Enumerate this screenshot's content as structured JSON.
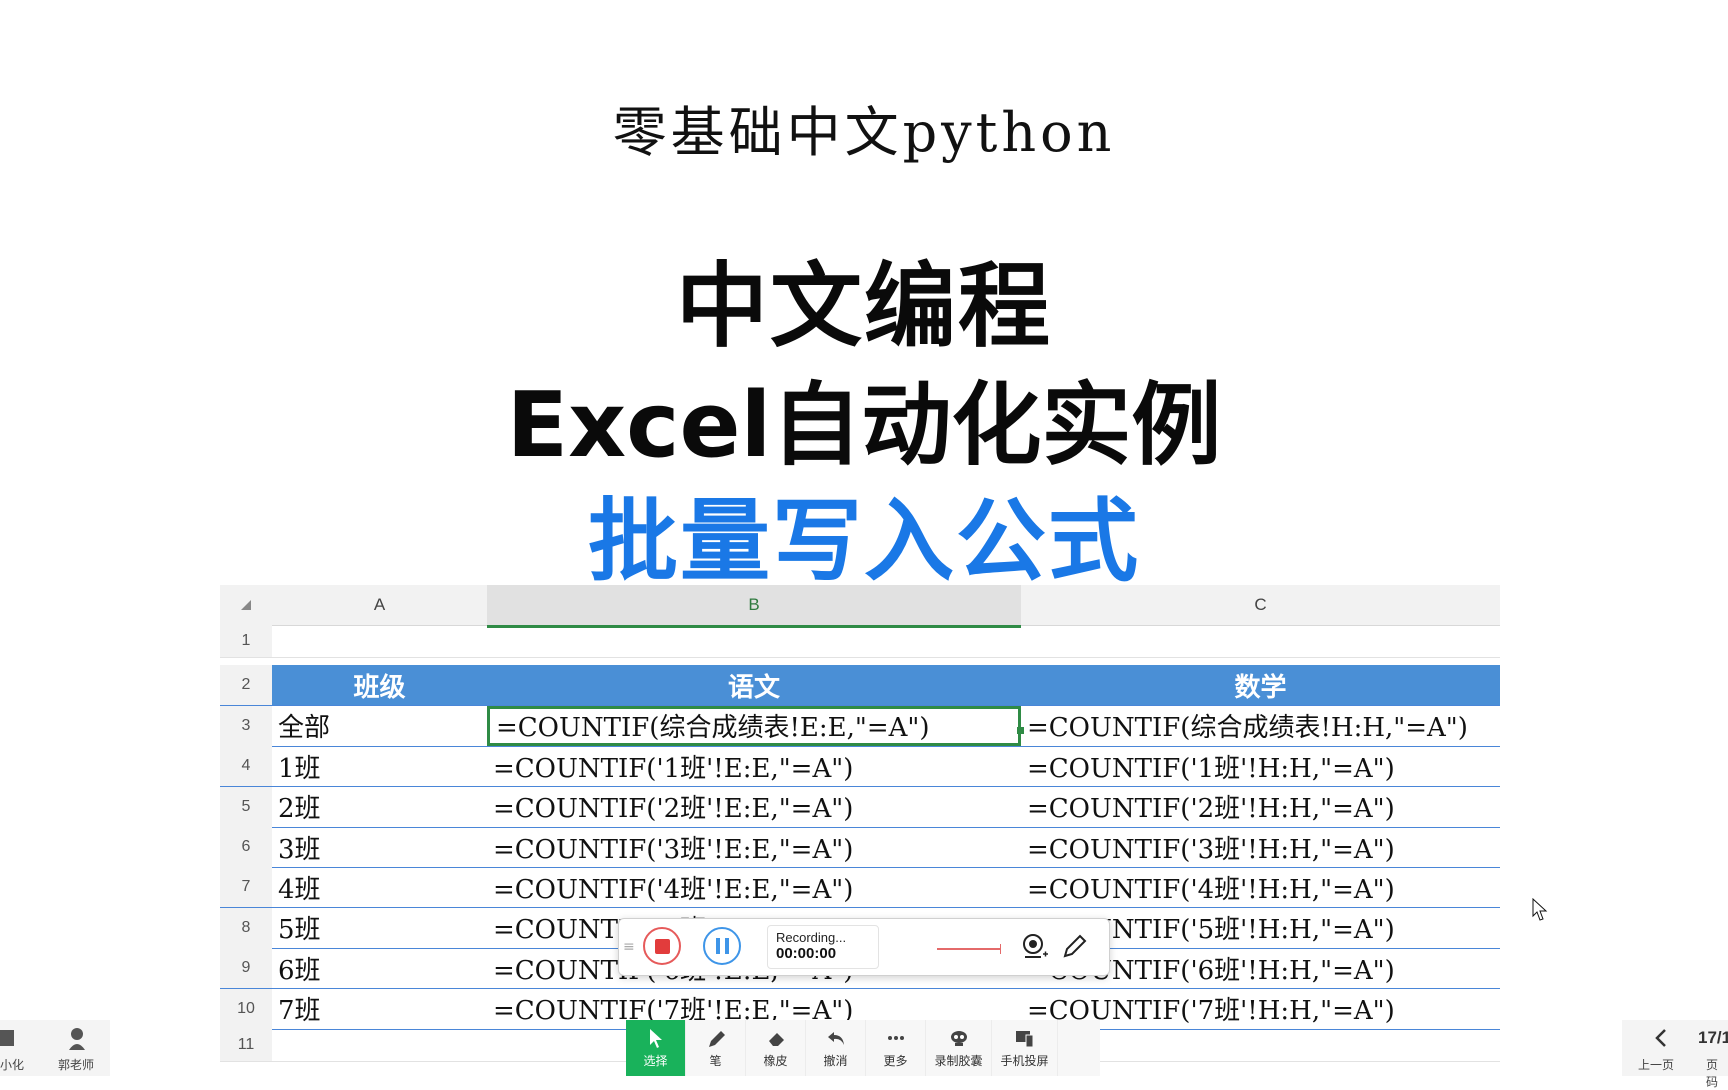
{
  "header": {
    "script_title": "零基础中文python",
    "line1": "中文编程",
    "line2": "Excel自动化实例",
    "line3": "批量写入公式"
  },
  "sheet": {
    "columns": [
      "A",
      "B",
      "C"
    ],
    "rows": [
      {
        "num": "1",
        "a": "",
        "b": "",
        "c": ""
      },
      {
        "num": "2",
        "a": "班级",
        "b": "语文",
        "c": "数学"
      },
      {
        "num": "3",
        "a": "全部",
        "b": "=COUNTIF(综合成绩表!E:E,\"=A\")",
        "c": "=COUNTIF(综合成绩表!H:H,\"=A\")"
      },
      {
        "num": "4",
        "a": "1班",
        "b": "=COUNTIF('1班'!E:E,\"=A\")",
        "c": "=COUNTIF('1班'!H:H,\"=A\")"
      },
      {
        "num": "5",
        "a": "2班",
        "b": "=COUNTIF('2班'!E:E,\"=A\")",
        "c": "=COUNTIF('2班'!H:H,\"=A\")"
      },
      {
        "num": "6",
        "a": "3班",
        "b": "=COUNTIF('3班'!E:E,\"=A\")",
        "c": "=COUNTIF('3班'!H:H,\"=A\")"
      },
      {
        "num": "7",
        "a": "4班",
        "b": "=COUNTIF('4班'!E:E,\"=A\")",
        "c": "=COUNTIF('4班'!H:H,\"=A\")"
      },
      {
        "num": "8",
        "a": "5班",
        "b": "=COUNTIF('5班'!E:E,\"=A\")",
        "c": "=COUNTIF('5班'!H:H,\"=A\")"
      },
      {
        "num": "9",
        "a": "6班",
        "b": "=COUNTIF('6班'!E:E,\"=A\")",
        "c": "=COUNTIF('6班'!H:H,\"=A\")"
      },
      {
        "num": "10",
        "a": "7班",
        "b": "=COUNTIF('7班'!E:E,\"=A\")",
        "c": "=COUNTIF('7班'!H:H,\"=A\")"
      },
      {
        "num": "11",
        "a": "",
        "b": "",
        "c": ""
      }
    ]
  },
  "recorder": {
    "status": "Recording...",
    "time": "00:00:00",
    "grip": "≡"
  },
  "toolbar": {
    "tools": [
      {
        "label": "选择",
        "icon": "cursor-icon"
      },
      {
        "label": "笔",
        "icon": "pen-icon"
      },
      {
        "label": "橡皮",
        "icon": "eraser-icon"
      },
      {
        "label": "撤消",
        "icon": "undo-icon"
      },
      {
        "label": "更多",
        "icon": "more-icon"
      },
      {
        "label": "录制胶囊",
        "icon": "record-capsule-icon"
      },
      {
        "label": "手机投屏",
        "icon": "phone-cast-icon"
      }
    ]
  },
  "left_panel": {
    "minimize_label": "小化",
    "teacher_label": "郭老师"
  },
  "right_panel": {
    "prev_label": "上一页",
    "page_num": "17/1",
    "page_label": "页码"
  },
  "colors": {
    "accent_blue": "#1a78e6",
    "header_blue": "#4a8fd6",
    "select_green": "#2f8b45",
    "tool_active": "#19b25b"
  }
}
